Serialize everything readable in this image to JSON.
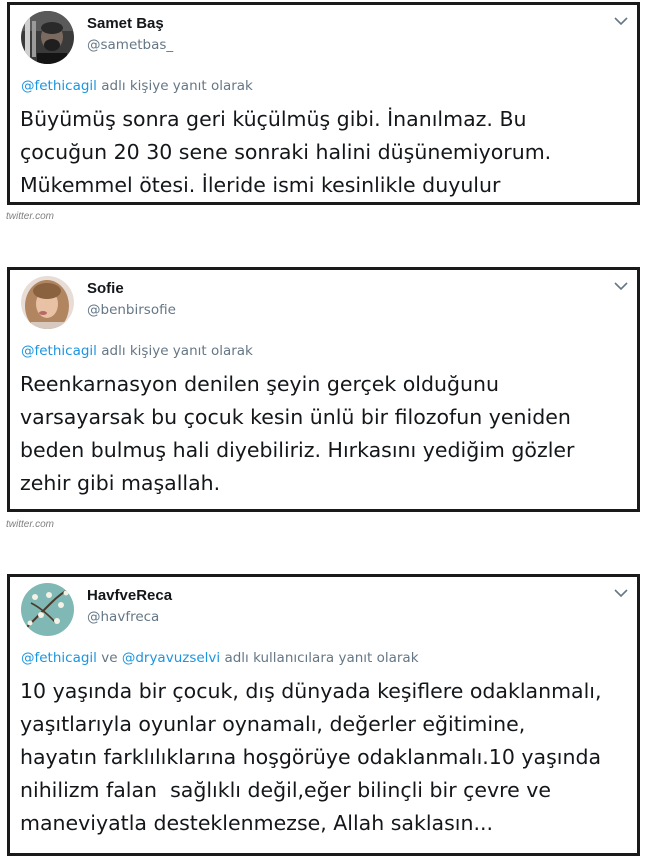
{
  "tweets": [
    {
      "name": "Samet Baş",
      "handle": "@sametbas_",
      "avatar_icon": "avatar-photo-samet",
      "reply": {
        "mentions": [
          "@fethicagil"
        ],
        "joiner": "",
        "suffix": " adlı kişiye yanıt olarak"
      },
      "lines": [
        "Büyümüş sonra geri küçülmüş gibi. İnanılmaz. Bu",
        "çocuğun 20 30 sene sonraki halini düşünemiyorum.",
        "Mükemmel ötesi. İleride ismi kesinlikle duyulur"
      ]
    },
    {
      "name": "Sofie",
      "handle": "@benbirsofie",
      "avatar_icon": "avatar-photo-sofie",
      "reply": {
        "mentions": [
          "@fethicagil"
        ],
        "joiner": "",
        "suffix": " adlı kişiye yanıt olarak"
      },
      "lines": [
        "Reenkarnasyon denilen şeyin gerçek olduğunu",
        "varsayarsak bu çocuk kesin ünlü bir filozofun yeniden",
        "beden bulmuş hali diyebiliriz. Hırkasını yediğim gözler",
        "zehir gibi maşallah."
      ]
    },
    {
      "name": "HavfveReca",
      "handle": "@havfreca",
      "avatar_icon": "avatar-almond-blossom",
      "reply": {
        "mentions": [
          "@fethicagil",
          "@dryavuzselvi"
        ],
        "joiner": " ve ",
        "suffix": " adlı kullanıcılara yanıt olarak"
      },
      "lines": [
        "10 yaşında bir çocuk, dış dünyada keşiflere odaklanmalı,",
        "yaşıtlarıyla oyunlar oynamalı, değerler eğitimine,",
        "hayatın farklılıklarına hoşgörüye odaklanmalı.10 yaşında",
        "nihilizm falan  sağlıklı değil,eğer bilinçli bir çevre ve",
        "maneviyatla desteklenmezse, Allah saklasın..."
      ]
    }
  ],
  "source_label": "twitter.com",
  "colors": {
    "mention": "#1b95e0",
    "muted": "#657786",
    "text": "#14171a",
    "border": "#1a1a1a"
  }
}
